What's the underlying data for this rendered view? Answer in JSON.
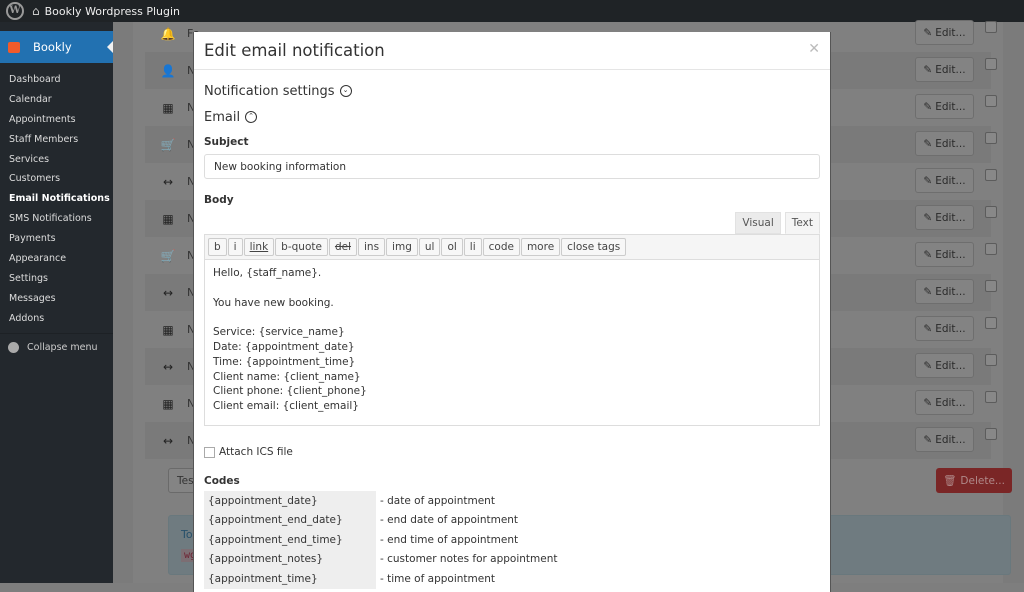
{
  "admin_bar": {
    "wp_icon": "wordpress-logo",
    "home_icon": "home-icon",
    "site_title": "Bookly Wordpress Plugin"
  },
  "sidebar": {
    "brand": "Bookly",
    "items": [
      {
        "label": "Dashboard"
      },
      {
        "label": "Calendar"
      },
      {
        "label": "Appointments"
      },
      {
        "label": "Staff Members"
      },
      {
        "label": "Services"
      },
      {
        "label": "Customers"
      },
      {
        "label": "Email Notifications",
        "current": true
      },
      {
        "label": "SMS Notifications"
      },
      {
        "label": "Payments"
      },
      {
        "label": "Appearance"
      },
      {
        "label": "Settings"
      },
      {
        "label": "Messages"
      },
      {
        "label": "Addons"
      }
    ],
    "collapse": "Collapse menu"
  },
  "background": {
    "rows": [
      {
        "icon": "bell",
        "label": "Fo"
      },
      {
        "icon": "user-plus",
        "label": "Ne"
      },
      {
        "icon": "calendar-check",
        "label": "No"
      },
      {
        "icon": "cart",
        "label": "No"
      },
      {
        "icon": "arrows-h",
        "label": "No"
      },
      {
        "icon": "calendar-check",
        "label": "No"
      },
      {
        "icon": "cart",
        "label": "No"
      },
      {
        "icon": "arrows-h",
        "label": "No"
      },
      {
        "icon": "calendar-check",
        "label": "No"
      },
      {
        "icon": "arrows-h",
        "label": "No"
      },
      {
        "icon": "calendar-check",
        "label": "No"
      },
      {
        "icon": "arrows-h",
        "label": "No"
      }
    ],
    "edit_label": "Edit...",
    "test_email": "Test em",
    "delete_label": "Delete...",
    "info_text": "To sen",
    "info_code": "wget"
  },
  "modal": {
    "title": "Edit email notification",
    "notification_settings": "Notification settings",
    "email_section": "Email",
    "subject_label": "Subject",
    "subject_value": "New booking information",
    "body_label": "Body",
    "tabs": [
      "Visual",
      "Text"
    ],
    "active_tab": "Text",
    "quicktags": [
      "b",
      "i",
      "link",
      "b-quote",
      "del",
      "ins",
      "img",
      "ul",
      "ol",
      "li",
      "code",
      "more",
      "close tags"
    ],
    "body_text": "Hello, {staff_name}.\n\nYou have new booking.\n\nService: {service_name}\nDate: {appointment_date}\nTime: {appointment_time}\nClient name: {client_name}\nClient phone: {client_phone}\nClient email: {client_email}",
    "attach_ics": "Attach ICS file",
    "attach_checked": false,
    "codes_label": "Codes",
    "codes": [
      {
        "code": "{appointment_date}",
        "desc": "- date of appointment"
      },
      {
        "code": "{appointment_end_date}",
        "desc": "- end date of appointment"
      },
      {
        "code": "{appointment_end_time}",
        "desc": "- end time of appointment"
      },
      {
        "code": "{appointment_notes}",
        "desc": "- customer notes for appointment"
      },
      {
        "code": "{appointment_time}",
        "desc": "- time of appointment"
      }
    ]
  },
  "colors": {
    "sidebar_active": "#2271b1",
    "delete": "#c9302c"
  }
}
